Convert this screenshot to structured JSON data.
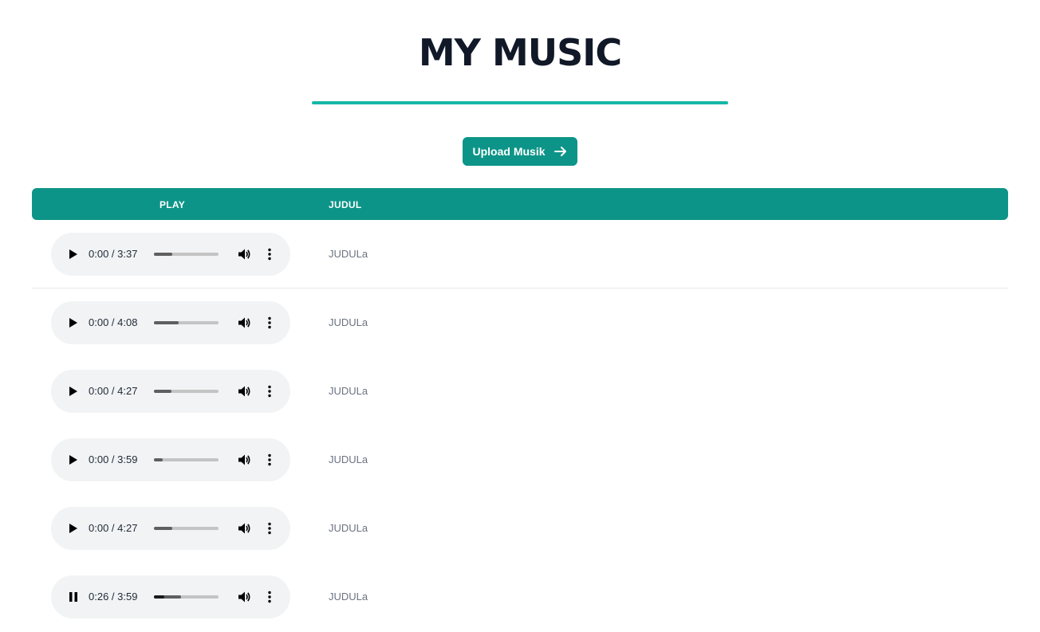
{
  "page": {
    "title": "MY MUSIC"
  },
  "upload": {
    "label": "Upload Musik",
    "icon": "arrow-right-icon"
  },
  "table": {
    "columns": [
      "PLAY",
      "JUDUL"
    ],
    "header_color": "#0d9488",
    "rows": [
      {
        "time": "0:00 / 3:37",
        "state": "paused",
        "buffered_fraction": 0.28,
        "played_fraction": 0.0,
        "title": "JUDULa"
      },
      {
        "time": "0:00 / 4:08",
        "state": "paused",
        "buffered_fraction": 0.38,
        "played_fraction": 0.0,
        "title": "JUDULa"
      },
      {
        "time": "0:00 / 4:27",
        "state": "paused",
        "buffered_fraction": 0.27,
        "played_fraction": 0.0,
        "title": "JUDULa"
      },
      {
        "time": "0:00 / 3:59",
        "state": "paused",
        "buffered_fraction": 0.13,
        "played_fraction": 0.0,
        "title": "JUDULa"
      },
      {
        "time": "0:00 / 4:27",
        "state": "paused",
        "buffered_fraction": 0.29,
        "played_fraction": 0.0,
        "title": "JUDULa"
      },
      {
        "time": "0:26 / 3:59",
        "state": "playing",
        "buffered_fraction": 0.42,
        "played_fraction": 0.16,
        "title": "JUDULa"
      }
    ]
  },
  "colors": {
    "accent": "#14b8a6",
    "primary": "#0d9488",
    "heading": "#111827",
    "muted": "#6b7280"
  }
}
